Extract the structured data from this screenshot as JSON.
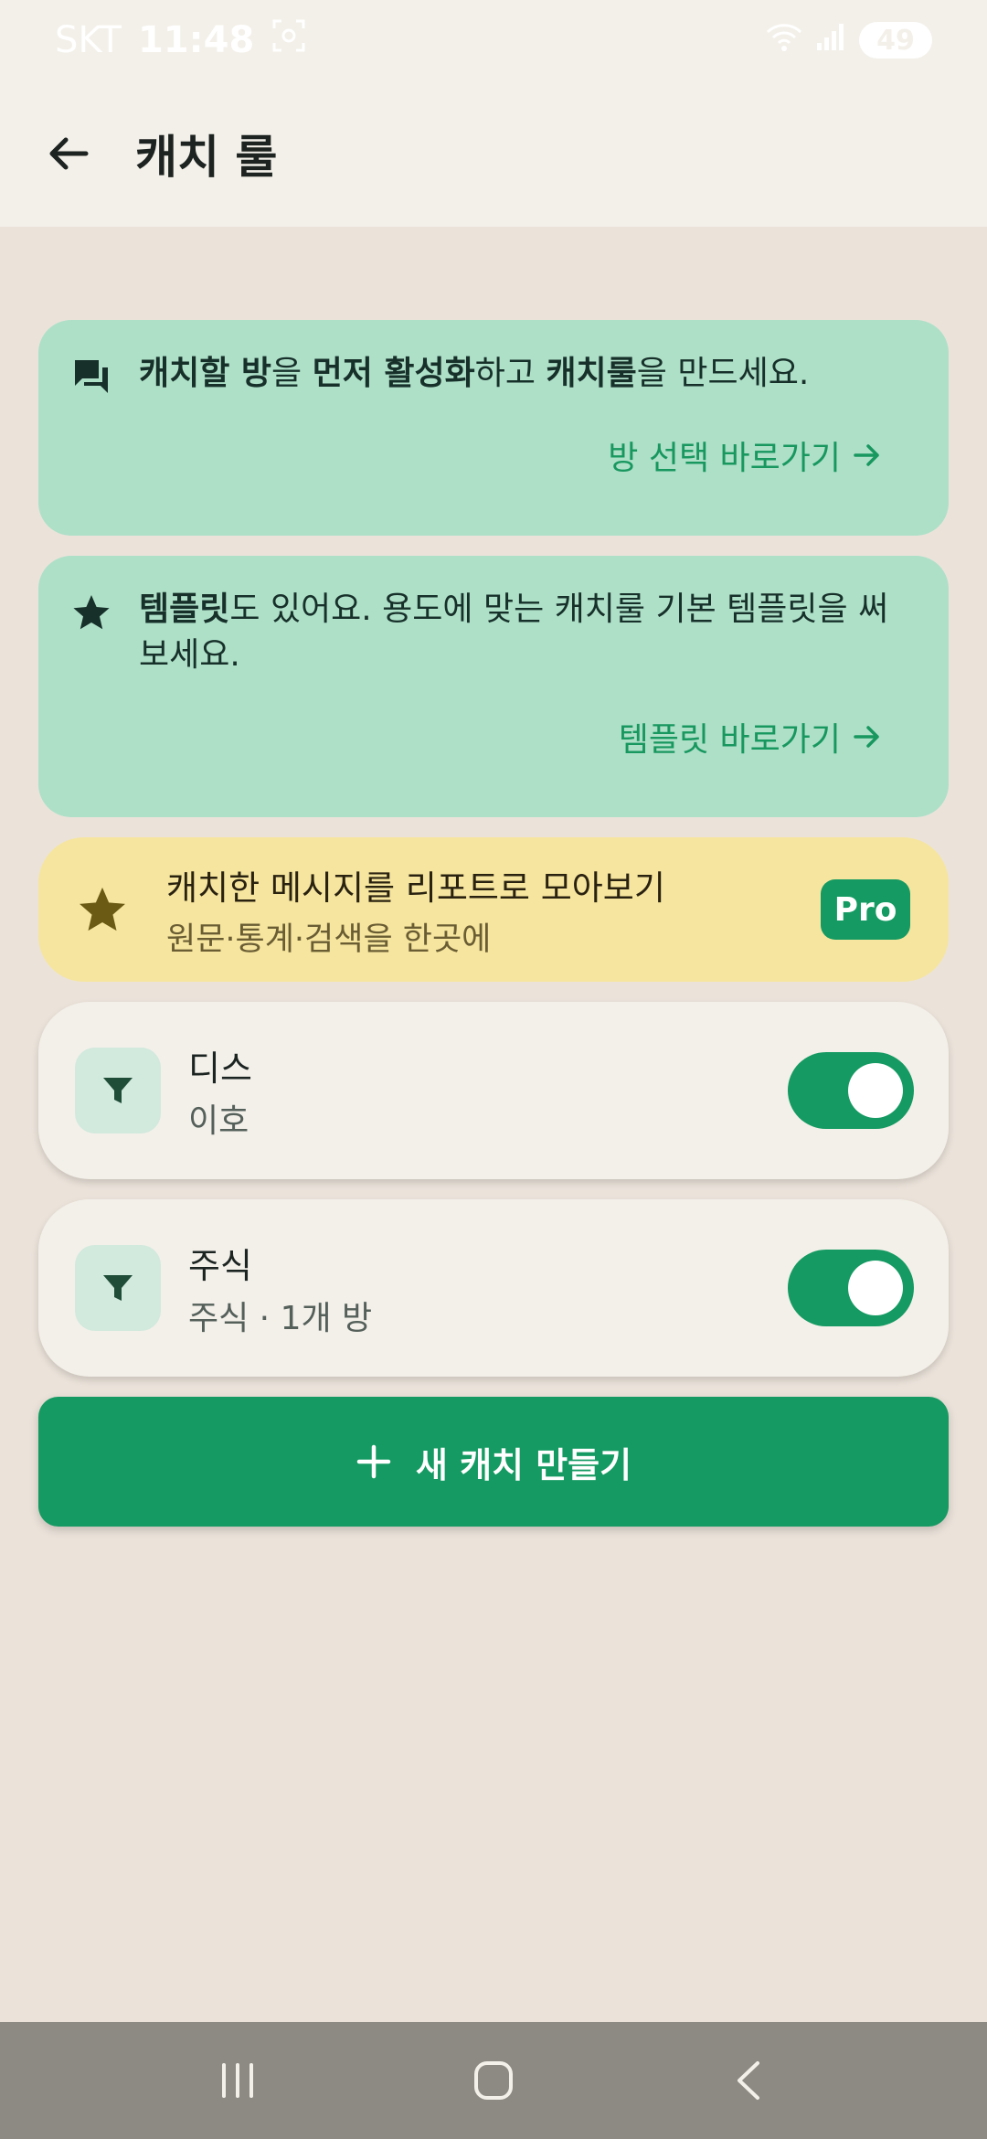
{
  "statusbar": {
    "carrier": "SKT",
    "time": "11:48",
    "battery": "49"
  },
  "appbar": {
    "title": "캐치 룰"
  },
  "info_cards": [
    {
      "parts": [
        {
          "text": "캐치할 방",
          "bold": true
        },
        {
          "text": "을 ",
          "bold": false
        },
        {
          "text": "먼저 활성화",
          "bold": true
        },
        {
          "text": "하고 ",
          "bold": false
        },
        {
          "text": "캐치룰",
          "bold": true
        },
        {
          "text": "을 만드세요.",
          "bold": false
        }
      ],
      "link": "방 선택 바로가기"
    },
    {
      "parts": [
        {
          "text": "템플릿",
          "bold": true
        },
        {
          "text": "도 있어요. 용도에 맞는 캐치룰 기본 템플릿을 써보세요.",
          "bold": false
        }
      ],
      "link": "템플릿 바로가기"
    }
  ],
  "pro_card": {
    "title": "캐치한 메시지를 리포트로 모아보기",
    "subtitle": "원문·통계·검색을 한곳에",
    "badge": "Pro"
  },
  "rules": [
    {
      "name": "디스",
      "subtitle": "이호",
      "enabled": true
    },
    {
      "name": "주식",
      "subtitle": "주식 · 1개 방",
      "enabled": true
    }
  ],
  "new_button": {
    "label": "새 캐치 만들기"
  },
  "colors": {
    "accent": "#149a62",
    "info_bg": "#aee0c8",
    "pro_bg": "#f6e59e",
    "page_bg": "#ebe3da"
  }
}
